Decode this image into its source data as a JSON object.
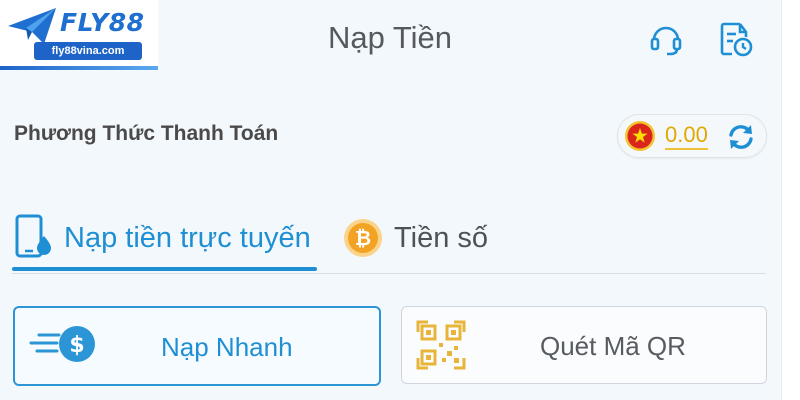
{
  "logo": {
    "brand": "FLY88",
    "domain": "fly88vina.com"
  },
  "header": {
    "title": "Nạp Tiền",
    "icons": [
      "headset-support-icon",
      "transaction-history-icon"
    ]
  },
  "section": {
    "title": "Phương Thức Thanh Toán",
    "balance": "0.00",
    "currency_flag": "vietnam-flag-icon"
  },
  "tabs": [
    {
      "label": "Nạp tiền trực tuyến",
      "icon": "mobile-deposit-icon",
      "active": true
    },
    {
      "label": "Tiền số",
      "icon": "bitcoin-icon",
      "active": false
    }
  ],
  "options": [
    {
      "label": "Nạp Nhanh",
      "icon": "fast-dollar-icon",
      "selected": true
    },
    {
      "label": "Quét Mã QR",
      "icon": "qr-code-icon",
      "selected": false
    }
  ],
  "colors": {
    "accent": "#1f8fd3",
    "brand": "#1e64c8",
    "balance": "#e0a800",
    "background": "#f3f8fc"
  }
}
